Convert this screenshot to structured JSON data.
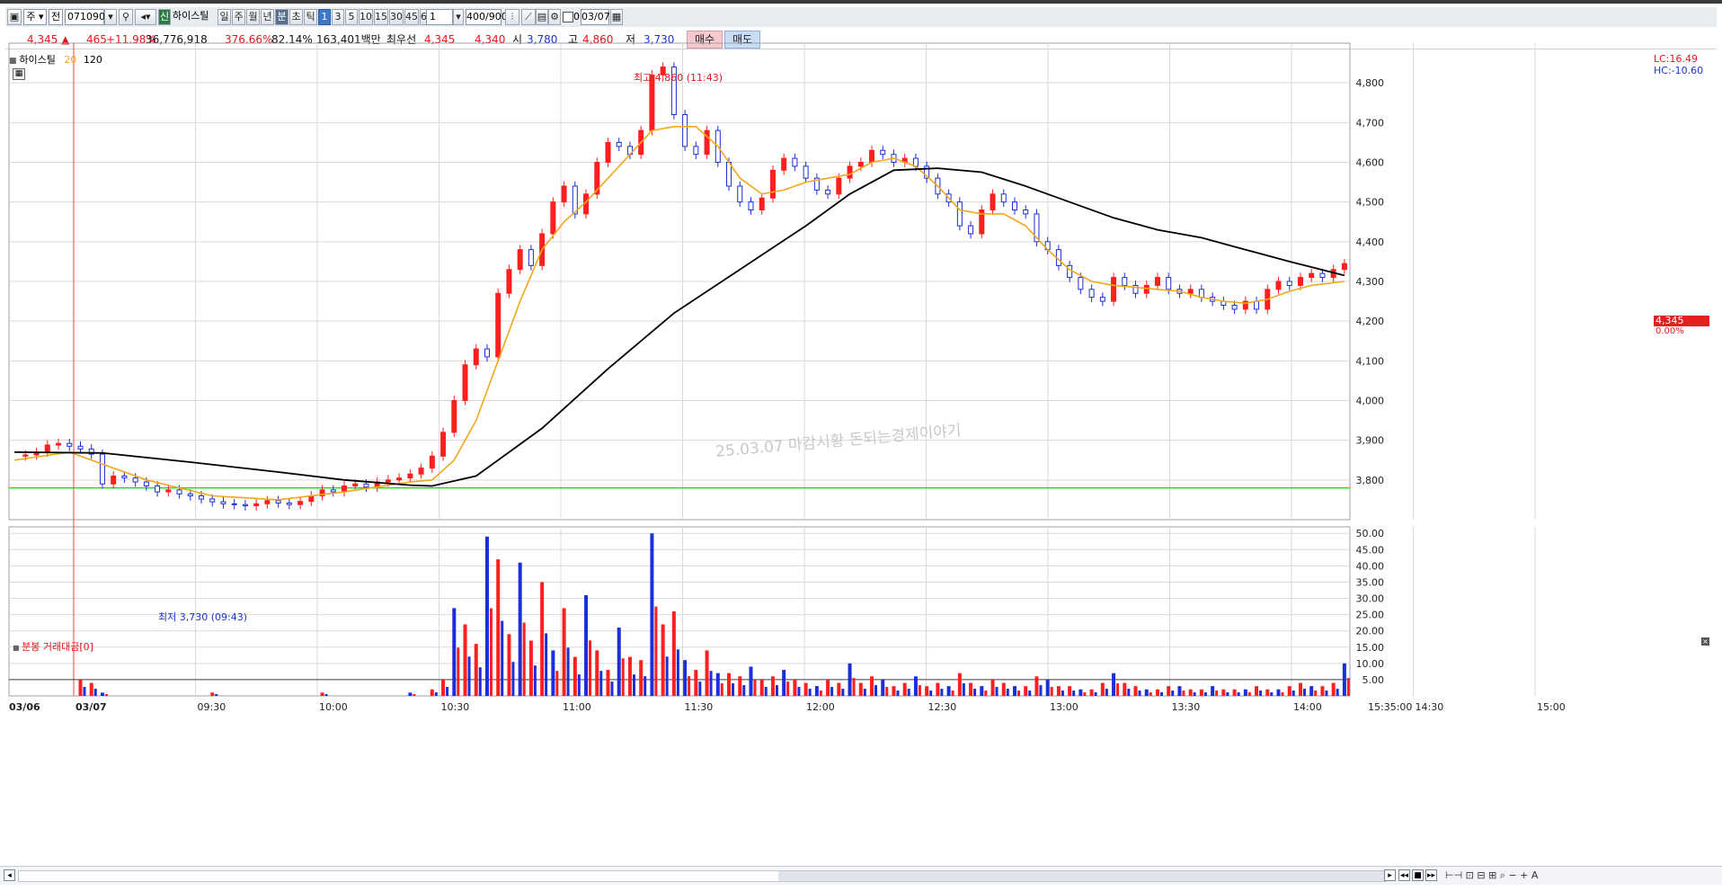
{
  "toolbar": {
    "type_label": "주",
    "market_label": "전",
    "code": "071090",
    "stock_badge": "신",
    "stock_name": "하이스틸",
    "periods": [
      "일",
      "주",
      "월",
      "년",
      "분",
      "초",
      "틱"
    ],
    "minutes": [
      "1",
      "3",
      "5",
      "10",
      "15",
      "30",
      "45",
      "60"
    ],
    "unit_value": "1",
    "count_label": "400/900",
    "check_label": "0",
    "date": "03/07"
  },
  "quote": {
    "price": "4,345 ▲",
    "change": "465",
    "change_pct": "+11.98%",
    "volume": "36,776,918",
    "volume_ratio": "376.66%",
    "turnover_ratio": "82.14%",
    "amount": "163,401백만",
    "best_label": "최우선",
    "ask": "4,345",
    "bid": "4,340",
    "open_label": "시",
    "open": "3,780",
    "high_label": "고",
    "high": "4,860",
    "low_label": "저",
    "low": "3,730",
    "buy_label": "매수",
    "sell_label": "매도"
  },
  "legend": {
    "name": "하이스틸",
    "ma_short": "20",
    "ma_long": "120"
  },
  "right_tags": {
    "lc": "LC:16.49",
    "hc": "HC:-10.60",
    "last_price": "4,345",
    "last_pct": "0.00%"
  },
  "annotations": {
    "high": "최고 4,860 (11:43)",
    "low": "최저 3,730 (09:43)",
    "watermark": "25.03.07 마감시황 돈되는경제이야기"
  },
  "volume_panel_title": "분봉 거래대금[0]",
  "colors": {
    "up": "#ff1f1f",
    "down": "#1a2fd8",
    "ma20": "#f0a81c",
    "ma120": "#000000",
    "hline": "#22dd22",
    "grid": "#d9d9d9"
  },
  "chart_data": {
    "type": "candlestick",
    "price_axis": {
      "ticks": [
        3800,
        3900,
        4000,
        4100,
        4200,
        4300,
        4400,
        4500,
        4600,
        4700,
        4800
      ],
      "ylim": [
        3700,
        4900
      ]
    },
    "volume_axis": {
      "ticks": [
        "5.00",
        "10.00",
        "15.00",
        "20.00",
        "25.00",
        "30.00",
        "35.00",
        "40.00",
        "45.00",
        "50.00"
      ],
      "ylim": [
        0,
        52
      ],
      "reference": 5
    },
    "time_axis": [
      "03/06",
      "03/07",
      "09:30",
      "10:00",
      "10:30",
      "11:00",
      "11:30",
      "12:00",
      "12:30",
      "13:00",
      "13:30",
      "14:00",
      "14:30",
      "15:00",
      "15:35:00"
    ],
    "horizontal_line": 3780,
    "price_path": [
      [
        0,
        3860
      ],
      [
        1,
        3863
      ],
      [
        2,
        3870
      ],
      [
        3,
        3888
      ],
      [
        4,
        3892
      ],
      [
        5,
        3885
      ],
      [
        6,
        3878
      ],
      [
        7,
        3865
      ],
      [
        8,
        3790
      ],
      [
        9,
        3810
      ],
      [
        10,
        3805
      ],
      [
        11,
        3795
      ],
      [
        12,
        3785
      ],
      [
        13,
        3770
      ],
      [
        14,
        3775
      ],
      [
        15,
        3765
      ],
      [
        16,
        3760
      ],
      [
        17,
        3752
      ],
      [
        18,
        3745
      ],
      [
        19,
        3740
      ],
      [
        20,
        3738
      ],
      [
        21,
        3735
      ],
      [
        22,
        3740
      ],
      [
        23,
        3748
      ],
      [
        24,
        3742
      ],
      [
        25,
        3738
      ],
      [
        26,
        3746
      ],
      [
        27,
        3760
      ],
      [
        28,
        3775
      ],
      [
        29,
        3770
      ],
      [
        30,
        3785
      ],
      [
        31,
        3790
      ],
      [
        32,
        3782
      ],
      [
        33,
        3795
      ],
      [
        34,
        3800
      ],
      [
        35,
        3805
      ],
      [
        36,
        3815
      ],
      [
        37,
        3830
      ],
      [
        38,
        3860
      ],
      [
        39,
        3920
      ],
      [
        40,
        4000
      ],
      [
        41,
        4090
      ],
      [
        42,
        4130
      ],
      [
        43,
        4110
      ],
      [
        44,
        4270
      ],
      [
        45,
        4330
      ],
      [
        46,
        4380
      ],
      [
        47,
        4340
      ],
      [
        48,
        4420
      ],
      [
        49,
        4500
      ],
      [
        50,
        4540
      ],
      [
        51,
        4470
      ],
      [
        52,
        4520
      ],
      [
        53,
        4600
      ],
      [
        54,
        4650
      ],
      [
        55,
        4640
      ],
      [
        56,
        4620
      ],
      [
        57,
        4680
      ],
      [
        58,
        4820
      ],
      [
        59,
        4840
      ],
      [
        60,
        4720
      ],
      [
        61,
        4640
      ],
      [
        62,
        4620
      ],
      [
        63,
        4680
      ],
      [
        64,
        4600
      ],
      [
        65,
        4540
      ],
      [
        66,
        4500
      ],
      [
        67,
        4480
      ],
      [
        68,
        4510
      ],
      [
        69,
        4580
      ],
      [
        70,
        4610
      ],
      [
        71,
        4590
      ],
      [
        72,
        4560
      ],
      [
        73,
        4530
      ],
      [
        74,
        4520
      ],
      [
        75,
        4560
      ],
      [
        76,
        4590
      ],
      [
        77,
        4600
      ],
      [
        78,
        4630
      ],
      [
        79,
        4620
      ],
      [
        80,
        4600
      ],
      [
        81,
        4610
      ],
      [
        82,
        4590
      ],
      [
        83,
        4560
      ],
      [
        84,
        4520
      ],
      [
        85,
        4500
      ],
      [
        86,
        4440
      ],
      [
        87,
        4420
      ],
      [
        88,
        4480
      ],
      [
        89,
        4520
      ],
      [
        90,
        4500
      ],
      [
        91,
        4480
      ],
      [
        92,
        4470
      ],
      [
        93,
        4400
      ],
      [
        94,
        4380
      ],
      [
        95,
        4340
      ],
      [
        96,
        4310
      ],
      [
        97,
        4280
      ],
      [
        98,
        4260
      ],
      [
        99,
        4250
      ],
      [
        100,
        4310
      ],
      [
        101,
        4290
      ],
      [
        102,
        4270
      ],
      [
        103,
        4290
      ],
      [
        104,
        4310
      ],
      [
        105,
        4280
      ],
      [
        106,
        4270
      ],
      [
        107,
        4280
      ],
      [
        108,
        4260
      ],
      [
        109,
        4250
      ],
      [
        110,
        4240
      ],
      [
        111,
        4230
      ],
      [
        112,
        4250
      ],
      [
        113,
        4230
      ],
      [
        114,
        4280
      ],
      [
        115,
        4300
      ],
      [
        116,
        4290
      ],
      [
        117,
        4310
      ],
      [
        118,
        4320
      ],
      [
        119,
        4310
      ],
      [
        120,
        4330
      ],
      [
        121,
        4345
      ]
    ],
    "ma20_path": [
      [
        0,
        3850
      ],
      [
        5,
        3870
      ],
      [
        8,
        3840
      ],
      [
        12,
        3800
      ],
      [
        18,
        3760
      ],
      [
        24,
        3750
      ],
      [
        30,
        3770
      ],
      [
        36,
        3795
      ],
      [
        38,
        3800
      ],
      [
        40,
        3850
      ],
      [
        42,
        3950
      ],
      [
        44,
        4100
      ],
      [
        46,
        4250
      ],
      [
        48,
        4380
      ],
      [
        50,
        4450
      ],
      [
        52,
        4500
      ],
      [
        54,
        4560
      ],
      [
        56,
        4620
      ],
      [
        58,
        4680
      ],
      [
        60,
        4690
      ],
      [
        62,
        4690
      ],
      [
        64,
        4640
      ],
      [
        66,
        4560
      ],
      [
        68,
        4520
      ],
      [
        70,
        4530
      ],
      [
        72,
        4550
      ],
      [
        74,
        4560
      ],
      [
        76,
        4570
      ],
      [
        78,
        4600
      ],
      [
        80,
        4610
      ],
      [
        82,
        4590
      ],
      [
        84,
        4540
      ],
      [
        86,
        4480
      ],
      [
        88,
        4470
      ],
      [
        90,
        4470
      ],
      [
        92,
        4440
      ],
      [
        94,
        4380
      ],
      [
        96,
        4330
      ],
      [
        98,
        4300
      ],
      [
        100,
        4290
      ],
      [
        102,
        4285
      ],
      [
        104,
        4280
      ],
      [
        106,
        4275
      ],
      [
        108,
        4260
      ],
      [
        110,
        4250
      ],
      [
        112,
        4245
      ],
      [
        114,
        4255
      ],
      [
        116,
        4275
      ],
      [
        118,
        4290
      ],
      [
        121,
        4300
      ]
    ],
    "ma120_path": [
      [
        0,
        3870
      ],
      [
        8,
        3868
      ],
      [
        16,
        3845
      ],
      [
        24,
        3820
      ],
      [
        30,
        3800
      ],
      [
        36,
        3787
      ],
      [
        38,
        3785
      ],
      [
        42,
        3810
      ],
      [
        48,
        3930
      ],
      [
        54,
        4080
      ],
      [
        60,
        4220
      ],
      [
        66,
        4330
      ],
      [
        72,
        4440
      ],
      [
        76,
        4520
      ],
      [
        80,
        4580
      ],
      [
        84,
        4585
      ],
      [
        88,
        4575
      ],
      [
        92,
        4540
      ],
      [
        96,
        4500
      ],
      [
        100,
        4460
      ],
      [
        104,
        4430
      ],
      [
        108,
        4410
      ],
      [
        112,
        4380
      ],
      [
        116,
        4350
      ],
      [
        121,
        4315
      ]
    ],
    "volume_bars": [
      [
        6,
        5
      ],
      [
        7,
        4
      ],
      [
        8,
        1
      ],
      [
        18,
        1
      ],
      [
        28,
        1
      ],
      [
        36,
        1
      ],
      [
        38,
        2
      ],
      [
        39,
        5
      ],
      [
        40,
        27
      ],
      [
        41,
        22
      ],
      [
        42,
        16
      ],
      [
        43,
        49
      ],
      [
        44,
        42
      ],
      [
        45,
        19
      ],
      [
        46,
        41
      ],
      [
        47,
        17
      ],
      [
        48,
        35
      ],
      [
        49,
        14
      ],
      [
        50,
        27
      ],
      [
        51,
        12
      ],
      [
        52,
        31
      ],
      [
        53,
        14
      ],
      [
        54,
        8
      ],
      [
        55,
        21
      ],
      [
        56,
        12
      ],
      [
        57,
        11
      ],
      [
        58,
        50
      ],
      [
        59,
        22
      ],
      [
        60,
        26
      ],
      [
        61,
        11
      ],
      [
        62,
        8
      ],
      [
        63,
        14
      ],
      [
        64,
        7
      ],
      [
        65,
        7
      ],
      [
        66,
        6
      ],
      [
        67,
        9
      ],
      [
        68,
        5
      ],
      [
        69,
        6
      ],
      [
        70,
        8
      ],
      [
        71,
        5
      ],
      [
        72,
        4
      ],
      [
        73,
        3
      ],
      [
        74,
        5
      ],
      [
        75,
        4
      ],
      [
        76,
        10
      ],
      [
        77,
        4
      ],
      [
        78,
        6
      ],
      [
        79,
        5
      ],
      [
        80,
        3
      ],
      [
        81,
        4
      ],
      [
        82,
        6
      ],
      [
        83,
        3
      ],
      [
        84,
        4
      ],
      [
        85,
        3
      ],
      [
        86,
        7
      ],
      [
        87,
        4
      ],
      [
        88,
        3
      ],
      [
        89,
        5
      ],
      [
        90,
        4
      ],
      [
        91,
        3
      ],
      [
        92,
        3
      ],
      [
        93,
        6
      ],
      [
        94,
        5
      ],
      [
        95,
        3
      ],
      [
        96,
        3
      ],
      [
        97,
        2
      ],
      [
        98,
        2
      ],
      [
        99,
        4
      ],
      [
        100,
        7
      ],
      [
        101,
        4
      ],
      [
        102,
        3
      ],
      [
        103,
        2
      ],
      [
        104,
        2
      ],
      [
        105,
        3
      ],
      [
        106,
        3
      ],
      [
        107,
        2
      ],
      [
        108,
        2
      ],
      [
        109,
        3
      ],
      [
        110,
        2
      ],
      [
        111,
        2
      ],
      [
        112,
        2
      ],
      [
        113,
        3
      ],
      [
        114,
        2
      ],
      [
        115,
        2
      ],
      [
        116,
        3
      ],
      [
        117,
        4
      ],
      [
        118,
        3
      ],
      [
        119,
        3
      ],
      [
        120,
        4
      ],
      [
        121,
        10
      ]
    ]
  }
}
